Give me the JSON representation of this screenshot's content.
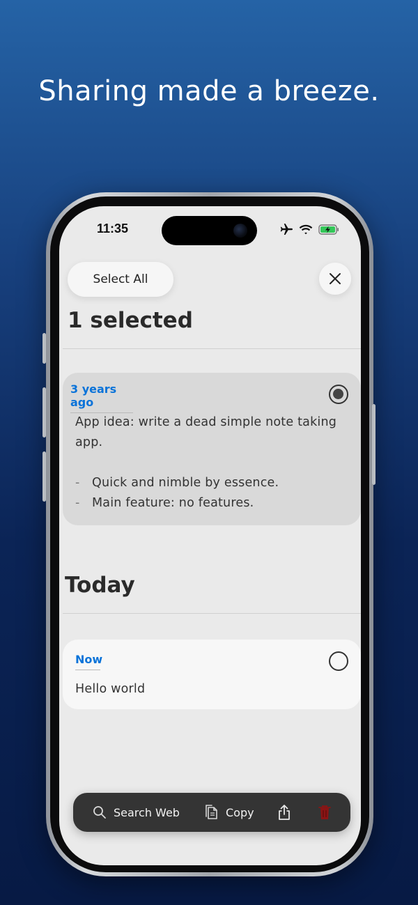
{
  "headline": "Sharing made a breeze.",
  "status_bar": {
    "time": "11:35",
    "icons": [
      "airplane-icon",
      "wifi-icon",
      "battery-charging-icon"
    ]
  },
  "header": {
    "select_all_label": "Select All",
    "selected_count_title": "1 selected",
    "close_icon": "close-icon"
  },
  "notes": [
    {
      "date": "3 years ago",
      "selected": true,
      "paragraph": "App idea: write a dead simple note taking app.",
      "bullets": [
        "Quick and nimble by essence.",
        "Main feature: no features."
      ]
    }
  ],
  "sections": [
    {
      "title": "Today",
      "notes": [
        {
          "date": "Now",
          "selected": false,
          "text": "Hello world"
        }
      ]
    }
  ],
  "toolbar": {
    "search_web_label": "Search Web",
    "copy_label": "Copy",
    "share_icon": "share-icon",
    "delete_icon": "trash-icon"
  },
  "colors": {
    "accent_blue": "#0a73d9",
    "delete_red": "#8b1414",
    "toolbar_bg": "#343434",
    "selected_card_bg": "#d9d9d9"
  }
}
